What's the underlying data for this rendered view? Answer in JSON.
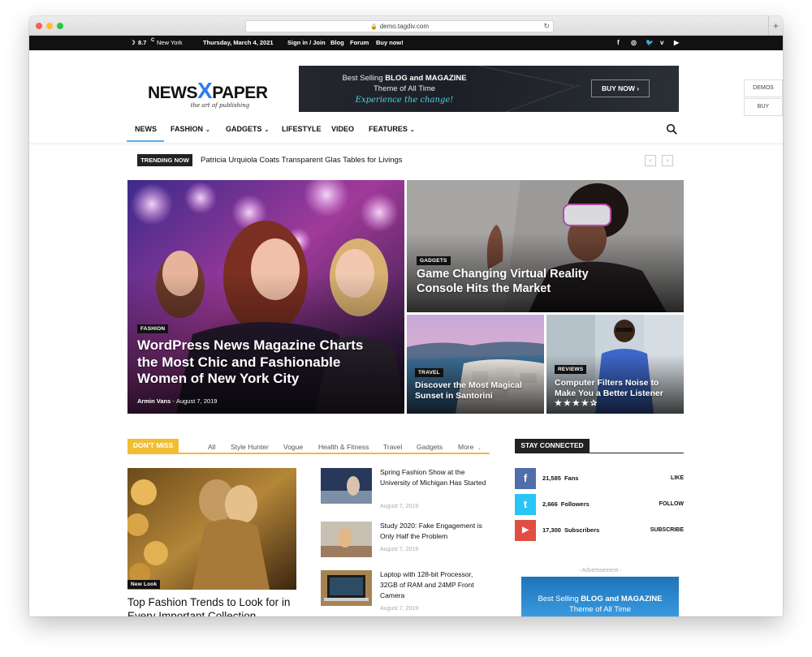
{
  "browser": {
    "url": "demo.tagdiv.com"
  },
  "topbar": {
    "temperature": "8.7",
    "unit": "C",
    "city": "New York",
    "date": "Thursday, March 4, 2021",
    "links": [
      "Sign in / Join",
      "Blog",
      "Forum",
      "Buy now!"
    ],
    "social_icons": [
      "facebook-icon",
      "instagram-icon",
      "twitter-icon",
      "vimeo-icon",
      "youtube-icon"
    ]
  },
  "logo": {
    "part1": "NEWS",
    "part2": "X",
    "part3": "PAPER",
    "tagline": "the art of publishing"
  },
  "banner": {
    "line1_a": "Best Selling ",
    "line1_b": "BLOG and MAGAZINE",
    "line2": "Theme of All Time",
    "line3": "Experience the change!",
    "cta": "BUY NOW ›"
  },
  "side_buttons": {
    "demos": "DEMOS",
    "buy": "BUY"
  },
  "nav": {
    "items": [
      {
        "label": "NEWS",
        "has_dropdown": false
      },
      {
        "label": "FASHION",
        "has_dropdown": true
      },
      {
        "label": "GADGETS",
        "has_dropdown": true
      },
      {
        "label": "LIFESTYLE",
        "has_dropdown": false
      },
      {
        "label": "VIDEO",
        "has_dropdown": false
      },
      {
        "label": "FEATURES",
        "has_dropdown": true
      }
    ],
    "accent": "#4db2ec"
  },
  "trending": {
    "badge": "TRENDING NOW",
    "headline": "Patricia Urquiola Coats Transparent Glas Tables for Livings",
    "prev": "‹",
    "next": "›"
  },
  "hero": {
    "main": {
      "category": "FASHION",
      "title": "WordPress News Magazine Charts the Most Chic and Fashionable Women of New York City",
      "author": "Armin Vans",
      "date": "August 7, 2019"
    },
    "top_right": {
      "category": "GADGETS",
      "title": "Game Changing Virtual Reality Console Hits the Market"
    },
    "bottom_left": {
      "category": "TRAVEL",
      "title": "Discover the Most Magical Sunset in Santorini"
    },
    "bottom_right": {
      "category": "REVIEWS",
      "title": "Computer Filters Noise to Make You a Better Listener",
      "stars": "★★★★✰",
      "rating": 4.5
    }
  },
  "dont_miss": {
    "badge": "DON'T MISS",
    "tabs": [
      "All",
      "Style Hunter",
      "Vogue",
      "Health & Fitness",
      "Travel",
      "Gadgets",
      "More"
    ],
    "accent": "#f2bd33",
    "main": {
      "badge": "New Look",
      "title": "Top Fashion Trends to Look for in Every Important Collection"
    },
    "list": [
      {
        "title": "Spring Fashion Show at the University of Michigan Has Started",
        "date": "August 7, 2019"
      },
      {
        "title": "Study 2020: Fake Engagement is Only Half the Problem",
        "date": "August 7, 2019"
      },
      {
        "title": "Laptop with 128-bit Processor, 32GB of RAM and 24MP Front Camera",
        "date": "August 7, 2019"
      }
    ]
  },
  "stay_connected": {
    "badge": "STAY CONNECTED",
    "rows": [
      {
        "icon": "facebook-icon",
        "glyph": "f",
        "color": "#516eab",
        "count": "21,585",
        "label": "Fans",
        "action": "LIKE"
      },
      {
        "icon": "twitter-icon",
        "glyph": "t",
        "color": "#29c5f6",
        "count": "2,666",
        "label": "Followers",
        "action": "FOLLOW"
      },
      {
        "icon": "youtube-icon",
        "glyph": "▶",
        "color": "#e14e42",
        "count": "17,300",
        "label": "Subscribers",
        "action": "SUBSCRIBE"
      }
    ],
    "ad_label": "- Advertisement -",
    "ad_line1_a": "Best Selling ",
    "ad_line1_b": "BLOG and MAGAZINE",
    "ad_line2": "Theme of All Time"
  }
}
